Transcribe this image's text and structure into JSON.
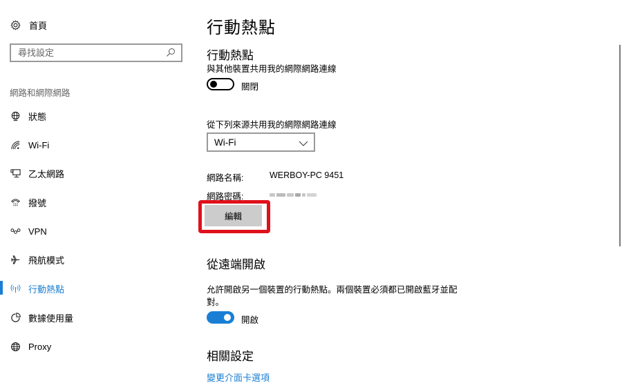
{
  "sidebar": {
    "home": {
      "label": "首頁",
      "icon": "gear-icon"
    },
    "search": {
      "placeholder": "尋找設定",
      "value": "",
      "icon": "search-icon"
    },
    "section_label": "網路和網際網路",
    "items": [
      {
        "label": "狀態",
        "icon": "globe-status-icon",
        "active": false
      },
      {
        "label": "Wi-Fi",
        "icon": "wifi-icon",
        "active": false
      },
      {
        "label": "乙太網路",
        "icon": "ethernet-icon",
        "active": false
      },
      {
        "label": "撥號",
        "icon": "dialup-icon",
        "active": false
      },
      {
        "label": "VPN",
        "icon": "vpn-icon",
        "active": false
      },
      {
        "label": "飛航模式",
        "icon": "airplane-icon",
        "active": false
      },
      {
        "label": "行動熱點",
        "icon": "hotspot-icon",
        "active": true
      },
      {
        "label": "數據使用量",
        "icon": "data-usage-icon",
        "active": false
      },
      {
        "label": "Proxy",
        "icon": "proxy-globe-icon",
        "active": false
      }
    ]
  },
  "main": {
    "title": "行動熱點",
    "hotspot": {
      "heading": "行動熱點",
      "description": "與其他裝置共用我的網際網路連線",
      "toggle_state": "off",
      "toggle_label": "關閉"
    },
    "share_from": {
      "label": "從下列來源共用我的網際網路連線",
      "selected": "Wi-Fi"
    },
    "network_name": {
      "key": "網路名稱:",
      "value": "WERBOY-PC 9451"
    },
    "network_password": {
      "key": "網路密碼:",
      "value": "(blurred)"
    },
    "edit_button": "編輯",
    "remote": {
      "heading": "從遠端開啟",
      "description_line1": "允許開啟另一個裝置的行動熱點。兩個裝置必須都已開啟藍牙並配",
      "description_line2": "對。",
      "toggle_state": "on",
      "toggle_label": "開啟"
    },
    "related": {
      "heading": "相關設定",
      "link": "變更介面卡選項"
    }
  },
  "colors": {
    "accent": "#1a7fd4",
    "highlight": "#e0101b",
    "button_bg": "#cccccc"
  }
}
